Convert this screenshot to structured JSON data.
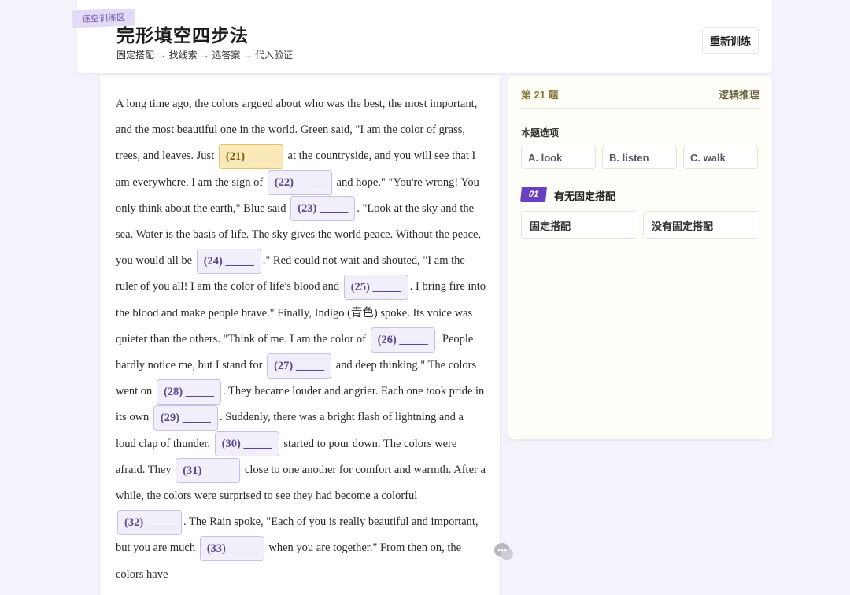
{
  "header": {
    "tag": "逐空训练区",
    "title": "完形填空四步法",
    "subtitle": "固定搭配 → 找线索 → 选答案 → 代入验证",
    "retrain_label": "重新训练"
  },
  "passage": {
    "segments": [
      {
        "t": "A long time ago, the colors argued about who was the best, the most important, and the most beautiful one in the world. Green said, \"I am the color of grass, trees, and leaves. Just "
      },
      {
        "b": "(21) _____",
        "active": true
      },
      {
        "t": " at the countryside, and you will see that I am everywhere. I am the sign of "
      },
      {
        "b": "(22) _____"
      },
      {
        "t": " and hope.\" \"You're wrong! You only think about the earth,\" Blue said "
      },
      {
        "b": "(23) _____"
      },
      {
        "t": ". \"Look at the sky and the sea. Water is the basis of life. The sky gives the world peace. Without the peace, you would all be "
      },
      {
        "b": "(24) _____"
      },
      {
        "t": ".\" Red could not wait and shouted, \"I am the ruler of you all! I am the color of life's blood and "
      },
      {
        "b": "(25) _____"
      },
      {
        "t": ". I bring fire into the blood and make people brave.\" Finally, Indigo (青色) spoke. Its voice was quieter than the others. \"Think of me. I am the color of "
      },
      {
        "b": "(26) _____"
      },
      {
        "t": ". People hardly notice me, but I stand for "
      },
      {
        "b": "(27) _____"
      },
      {
        "t": " and deep thinking.\" The colors went on "
      },
      {
        "b": "(28) _____"
      },
      {
        "t": ". They became louder and angrier. Each one took pride in its own "
      },
      {
        "b": "(29) _____"
      },
      {
        "t": ". Suddenly, there was a bright flash of lightning and a loud clap of thunder. "
      },
      {
        "b": "(30) _____"
      },
      {
        "t": " started to pour down. The colors were afraid. They "
      },
      {
        "b": "(31) _____"
      },
      {
        "t": " close to one another for comfort and warmth. After a while, the colors were surprised to see they had become a colorful "
      },
      {
        "b": "(32) _____"
      },
      {
        "t": ". The Rain spoke, \"Each of you is really beautiful and important, but you are much "
      },
      {
        "b": "(33) _____"
      },
      {
        "t": " when you are together.\" From then on, the colors have"
      }
    ]
  },
  "question": {
    "number": "第 21 题",
    "type": "逻辑推理",
    "options_label": "本题选项",
    "options": [
      "A. look",
      "B. listen",
      "C. walk"
    ],
    "step": {
      "badge": "01",
      "title": "有无固定搭配",
      "choices": [
        "固定搭配",
        "没有固定搭配"
      ]
    }
  },
  "colors": {
    "accent": "#6a3fc0",
    "active_blank": "#fbeab8",
    "blank": "#f3effa"
  },
  "icons": {
    "chat": "chat-bubble-icon"
  }
}
